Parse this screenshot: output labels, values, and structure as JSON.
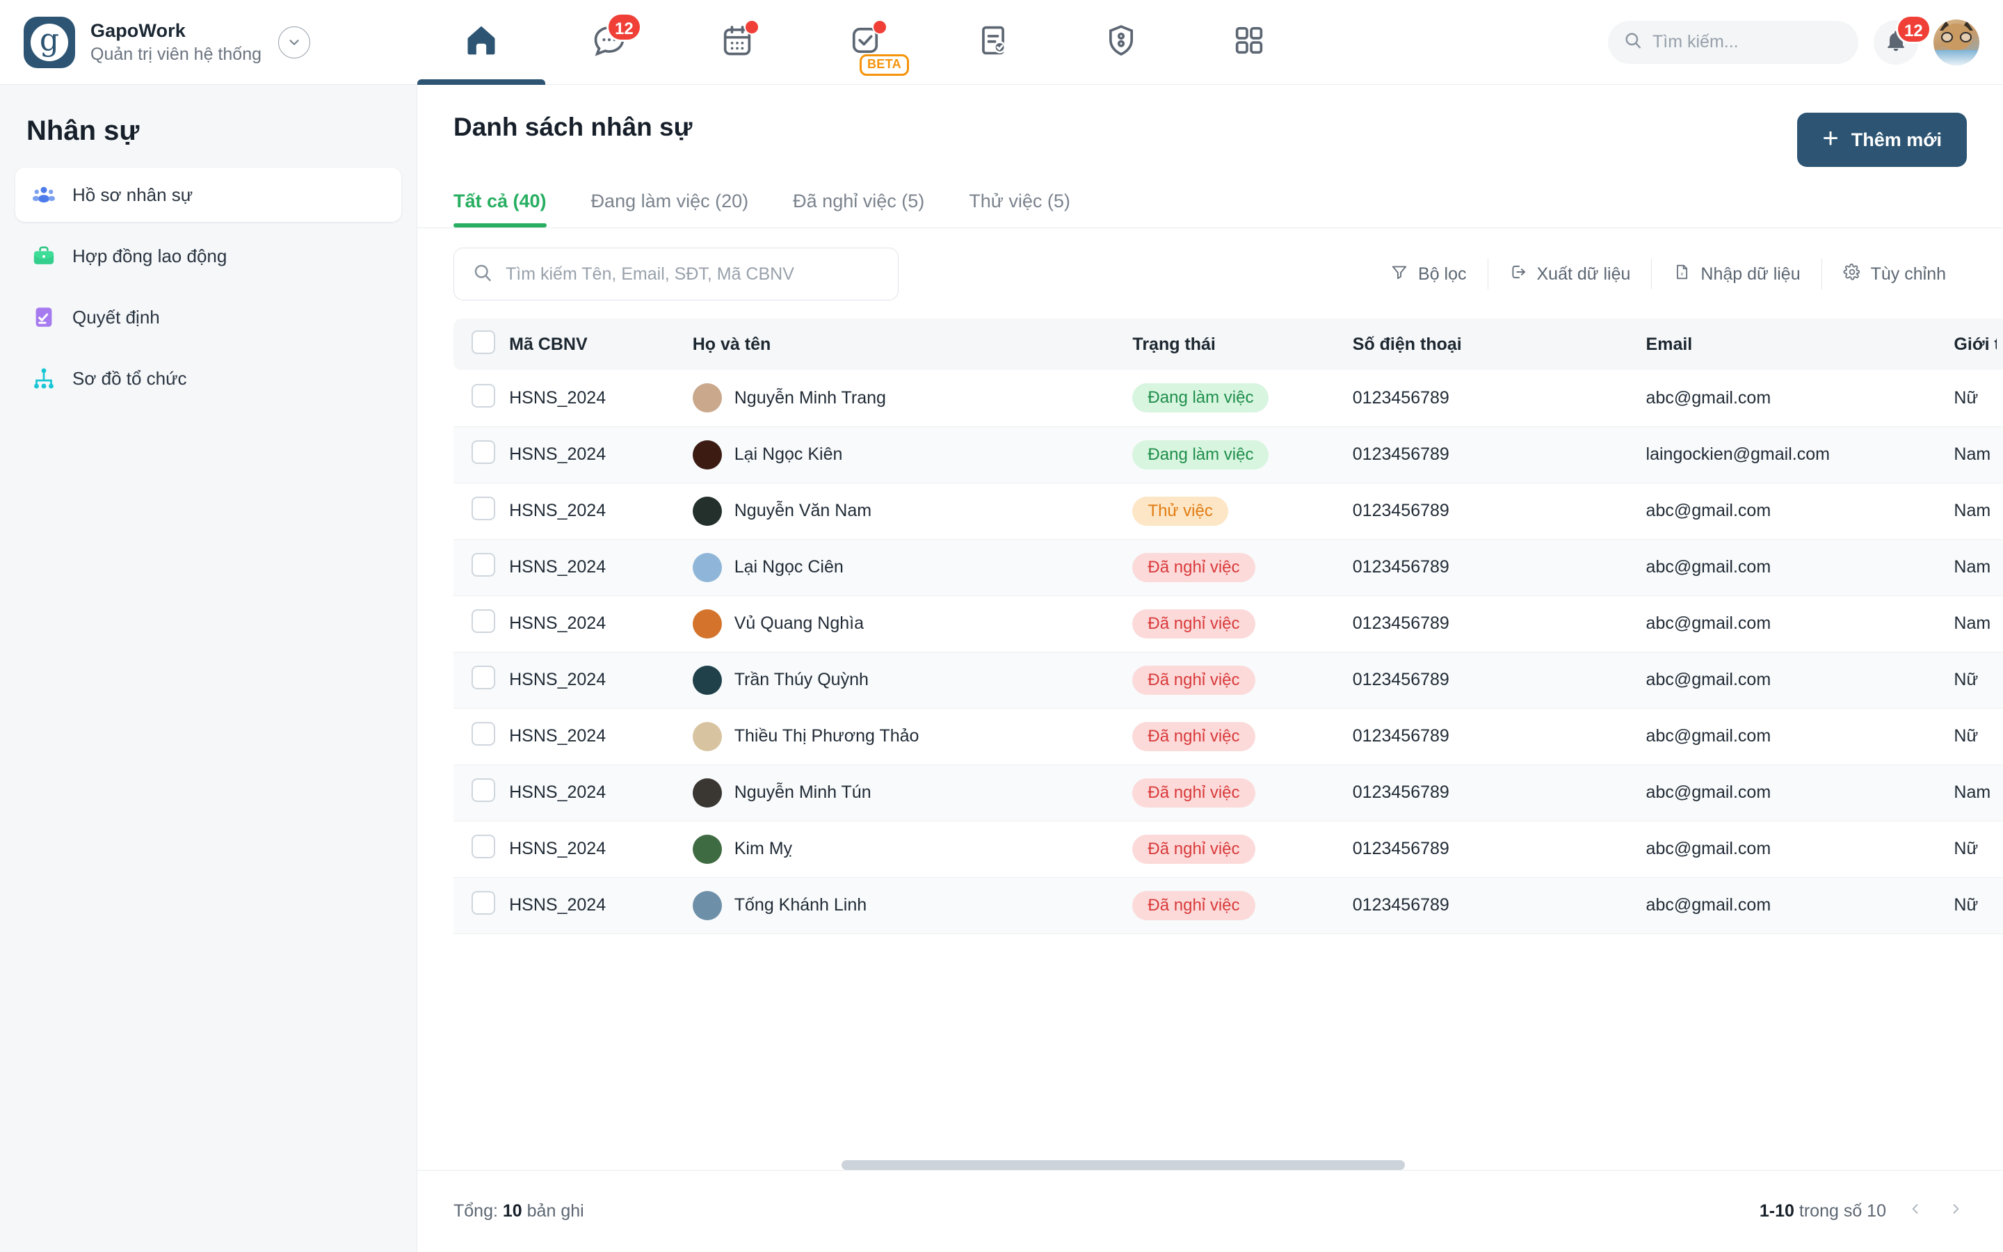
{
  "brand": {
    "logo_letter": "g",
    "title": "GapoWork",
    "subtitle": "Quản trị viên hệ thống",
    "chevron_icon": "chevron-down-icon"
  },
  "topnav": {
    "items": [
      {
        "icon": "home-icon",
        "active": true,
        "badge": "",
        "dot": false,
        "tag": ""
      },
      {
        "icon": "chat-icon",
        "active": false,
        "badge": "12",
        "dot": false,
        "tag": ""
      },
      {
        "icon": "calendar-icon",
        "active": false,
        "badge": "",
        "dot": true,
        "tag": ""
      },
      {
        "icon": "task-check-icon",
        "active": false,
        "badge": "",
        "dot": true,
        "tag": "BETA"
      },
      {
        "icon": "document-check-icon",
        "active": false,
        "badge": "",
        "dot": false,
        "tag": ""
      },
      {
        "icon": "id-badge-icon",
        "active": false,
        "badge": "",
        "dot": false,
        "tag": ""
      },
      {
        "icon": "apps-grid-icon",
        "active": false,
        "badge": "",
        "dot": false,
        "tag": ""
      }
    ]
  },
  "header_right": {
    "search_placeholder": "Tìm kiếm...",
    "search_value": "",
    "search_icon": "search-icon",
    "bell_icon": "bell-icon",
    "bell_badge": "12",
    "avatar_icon": "user-avatar"
  },
  "sidebar": {
    "title": "Nhân sự",
    "items": [
      {
        "label": "Hồ sơ nhân sự",
        "icon": "people-group-icon",
        "active": true
      },
      {
        "label": "Hợp đồng lao động",
        "icon": "briefcase-icon",
        "active": false
      },
      {
        "label": "Quyết định",
        "icon": "checklist-icon",
        "active": false
      },
      {
        "label": "Sơ đồ tổ chức",
        "icon": "org-chart-icon",
        "active": false
      }
    ]
  },
  "main": {
    "page_title": "Danh sách nhân sự",
    "add_button": "Thêm mới",
    "add_icon": "plus-icon",
    "tabs": [
      {
        "label": "Tất cả (40)",
        "active": true
      },
      {
        "label": "Đang làm việc (20)",
        "active": false
      },
      {
        "label": "Đã nghỉ việc (5)",
        "active": false
      },
      {
        "label": "Thử việc (5)",
        "active": false
      }
    ],
    "toolbar": {
      "search_placeholder": "Tìm kiếm Tên, Email, SĐT, Mã CBNV",
      "search_value": "",
      "search_icon": "search-icon",
      "actions": [
        {
          "label": "Bộ lọc",
          "icon": "filter-icon"
        },
        {
          "label": "Xuất dữ liệu",
          "icon": "export-icon"
        },
        {
          "label": "Nhập dữ liệu",
          "icon": "import-excel-icon"
        },
        {
          "label": "Tùy chỉnh",
          "icon": "gear-icon"
        }
      ]
    },
    "table": {
      "columns": [
        "",
        "Mã CBNV",
        "Họ và tên",
        "Trạng thái",
        "Số điện thoại",
        "Email",
        "Giới tính",
        ""
      ],
      "column_gender_clipped": "Giớ",
      "rows": [
        {
          "code": "HSNS_2024",
          "name": "Nguyễn Minh Trang",
          "status": "Đang làm việc",
          "status_kind": "work",
          "phone": "0123456789",
          "email": "abc@gmail.com",
          "gender": "Nữ",
          "avatar_color": "#c9a88c"
        },
        {
          "code": "HSNS_2024",
          "name": "Lại Ngọc Kiên",
          "status": "Đang làm việc",
          "status_kind": "work",
          "phone": "0123456789",
          "email": "laingockien@gmail.com",
          "gender": "Nam",
          "avatar_color": "#3b1b12"
        },
        {
          "code": "HSNS_2024",
          "name": "Nguyễn Văn Nam",
          "status": "Thử việc",
          "status_kind": "trial",
          "phone": "0123456789",
          "email": "abc@gmail.com",
          "gender": "Nam",
          "avatar_color": "#24302b"
        },
        {
          "code": "HSNS_2024",
          "name": "Lại Ngọc Ciên",
          "status": "Đã nghỉ việc",
          "status_kind": "quit",
          "phone": "0123456789",
          "email": "abc@gmail.com",
          "gender": "Nam",
          "avatar_color": "#8fb6d8"
        },
        {
          "code": "HSNS_2024",
          "name": "Vủ Quang Nghìa",
          "status": "Đã nghỉ việc",
          "status_kind": "quit",
          "phone": "0123456789",
          "email": "abc@gmail.com",
          "gender": "Nam",
          "avatar_color": "#d4742c"
        },
        {
          "code": "HSNS_2024",
          "name": "Trần Thúy Quỳnh",
          "status": "Đã nghỉ việc",
          "status_kind": "quit",
          "phone": "0123456789",
          "email": "abc@gmail.com",
          "gender": "Nữ",
          "avatar_color": "#20414a"
        },
        {
          "code": "HSNS_2024",
          "name": "Thiều Thị Phương Thảo",
          "status": "Đã nghỉ việc",
          "status_kind": "quit",
          "phone": "0123456789",
          "email": "abc@gmail.com",
          "gender": "Nữ",
          "avatar_color": "#d8c3a0"
        },
        {
          "code": "HSNS_2024",
          "name": "Nguyễn Minh Tún",
          "status": "Đã nghỉ việc",
          "status_kind": "quit",
          "phone": "0123456789",
          "email": "abc@gmail.com",
          "gender": "Nam",
          "avatar_color": "#3a3632"
        },
        {
          "code": "HSNS_2024",
          "name": "Kim Mỵ",
          "status": "Đã nghỉ việc",
          "status_kind": "quit",
          "phone": "0123456789",
          "email": "abc@gmail.com",
          "gender": "Nữ",
          "avatar_color": "#3f6b42"
        },
        {
          "code": "HSNS_2024",
          "name": "Tống Khánh Linh",
          "status": "Đã nghỉ việc",
          "status_kind": "quit",
          "phone": "0123456789",
          "email": "abc@gmail.com",
          "gender": "Nữ",
          "avatar_color": "#6e8fa8"
        }
      ],
      "row_action_icon": "more-horizontal-icon"
    },
    "footer": {
      "total_prefix": "Tổng:",
      "total_count": "10",
      "total_suffix": "bản ghi",
      "range": "1-10",
      "range_suffix": "trong số 10",
      "prev_icon": "chevron-left-icon",
      "next_icon": "chevron-right-icon"
    }
  },
  "colors": {
    "brand_dark": "#2d5573",
    "accent_green": "#27ae60",
    "badge_red": "#ef3f37",
    "beta_orange": "#f5930a"
  }
}
